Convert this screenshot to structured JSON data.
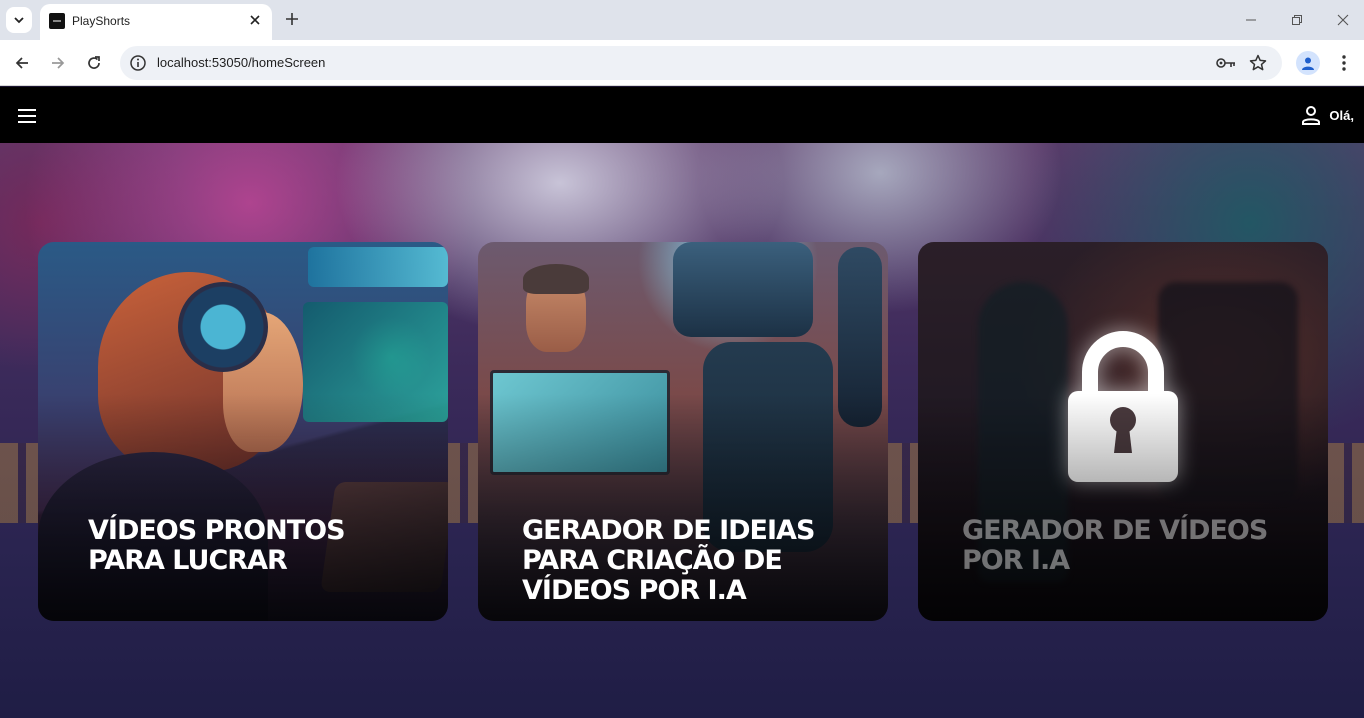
{
  "browser": {
    "tab_title": "PlayShorts",
    "url": "localhost:53050/homeScreen"
  },
  "app": {
    "greeting": "Olá,"
  },
  "cards": [
    {
      "title": "VÍDEOS PRONTOS PARA LUCRAR",
      "locked": false
    },
    {
      "title": "GERADOR DE IDEIAS PARA CRIAÇÃO DE VÍDEOS POR I.A",
      "locked": false
    },
    {
      "title": "GERADOR DE VÍDEOS POR I.A",
      "locked": true
    }
  ]
}
